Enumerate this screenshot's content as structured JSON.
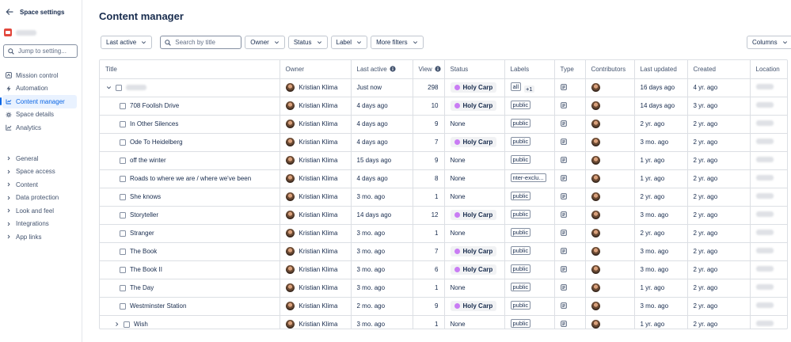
{
  "sidebar": {
    "title": "Space settings",
    "search_placeholder": "Jump to setting...",
    "nav": [
      {
        "label": "Mission control",
        "icon": "mission-control-icon"
      },
      {
        "label": "Automation",
        "icon": "lightning-icon"
      },
      {
        "label": "Content manager",
        "icon": "content-manager-icon",
        "active": true
      },
      {
        "label": "Space details",
        "icon": "space-details-icon"
      },
      {
        "label": "Analytics",
        "icon": "chart-icon"
      }
    ],
    "groups": [
      "General",
      "Space access",
      "Content",
      "Data protection",
      "Look and feel",
      "Integrations",
      "App links"
    ]
  },
  "page_title": "Content manager",
  "filters": {
    "last_active": "Last active",
    "search_placeholder": "Search by title",
    "owner": "Owner",
    "status": "Status",
    "label": "Label",
    "more_filters": "More filters",
    "columns": "Columns"
  },
  "table": {
    "headers": [
      "Title",
      "Owner",
      "Last active",
      "View",
      "Status",
      "Labels",
      "Type",
      "Contributors",
      "Last updated",
      "Created",
      "Location"
    ],
    "rows": [
      {
        "title": "",
        "owner": "Kristian Klima",
        "last_active": "Just now",
        "views": "298",
        "status": "Holy Carp",
        "label": "all",
        "label_extra": "+1",
        "last_updated": "16 days ago",
        "created": "4 yr. ago"
      },
      {
        "title": "708 Foolish Drive",
        "owner": "Kristian Klima",
        "last_active": "4 days ago",
        "views": "10",
        "status": "Holy Carp",
        "label": "public",
        "last_updated": "14 days ago",
        "created": "3 yr. ago"
      },
      {
        "title": "In Other Silences",
        "owner": "Kristian Klima",
        "last_active": "4 days ago",
        "views": "9",
        "status": "None",
        "label": "public",
        "last_updated": "2 yr. ago",
        "created": "2 yr. ago"
      },
      {
        "title": "Ode To Heidelberg",
        "owner": "Kristian Klima",
        "last_active": "4 days ago",
        "views": "7",
        "status": "Holy Carp",
        "label": "public",
        "last_updated": "3 mo. ago",
        "created": "2 yr. ago"
      },
      {
        "title": "off the winter",
        "owner": "Kristian Klima",
        "last_active": "15 days ago",
        "views": "9",
        "status": "None",
        "label": "public",
        "last_updated": "1 yr. ago",
        "created": "2 yr. ago"
      },
      {
        "title": "Roads to where we are / where we've been",
        "owner": "Kristian Klima",
        "last_active": "4 days ago",
        "views": "8",
        "status": "None",
        "label": "nter-exclu...",
        "last_updated": "1 yr. ago",
        "created": "2 yr. ago"
      },
      {
        "title": "She knows",
        "owner": "Kristian Klima",
        "last_active": "3 mo. ago",
        "views": "1",
        "status": "None",
        "label": "public",
        "last_updated": "2 yr. ago",
        "created": "2 yr. ago"
      },
      {
        "title": "Storyteller",
        "owner": "Kristian Klima",
        "last_active": "14 days ago",
        "views": "12",
        "status": "Holy Carp",
        "label": "public",
        "last_updated": "3 mo. ago",
        "created": "2 yr. ago"
      },
      {
        "title": "Stranger",
        "owner": "Kristian Klima",
        "last_active": "3 mo. ago",
        "views": "1",
        "status": "None",
        "label": "public",
        "last_updated": "2 yr. ago",
        "created": "2 yr. ago"
      },
      {
        "title": "The Book",
        "owner": "Kristian Klima",
        "last_active": "3 mo. ago",
        "views": "7",
        "status": "Holy Carp",
        "label": "public",
        "last_updated": "3 mo. ago",
        "created": "2 yr. ago"
      },
      {
        "title": "The Book II",
        "owner": "Kristian Klima",
        "last_active": "3 mo. ago",
        "views": "6",
        "status": "Holy Carp",
        "label": "public",
        "last_updated": "3 mo. ago",
        "created": "2 yr. ago"
      },
      {
        "title": "The Day",
        "owner": "Kristian Klima",
        "last_active": "3 mo. ago",
        "views": "1",
        "status": "None",
        "label": "public",
        "last_updated": "1 yr. ago",
        "created": "2 yr. ago"
      },
      {
        "title": "Westminster Station",
        "owner": "Kristian Klima",
        "last_active": "2 mo. ago",
        "views": "9",
        "status": "Holy Carp",
        "label": "public",
        "last_updated": "3 mo. ago",
        "created": "2 yr. ago"
      },
      {
        "title": "Wish",
        "owner": "Kristian Klima",
        "last_active": "3 mo. ago",
        "views": "1",
        "status": "None",
        "label": "public",
        "last_updated": "1 yr. ago",
        "created": "2 yr. ago"
      }
    ]
  },
  "colors": {
    "accent": "#0c66e4",
    "status_dot": "#c97cf4",
    "border": "#dcdfe4"
  }
}
